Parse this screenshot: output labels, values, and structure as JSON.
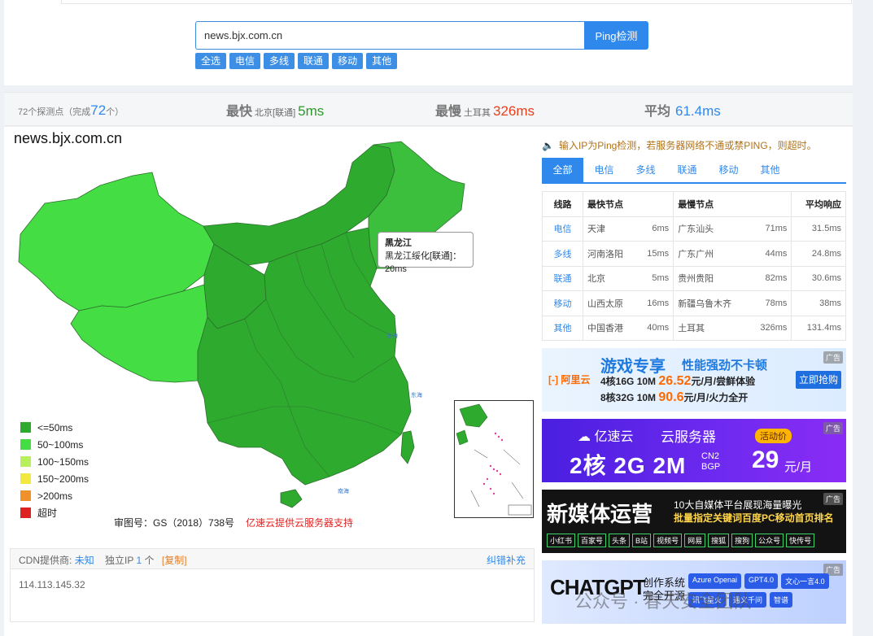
{
  "search": {
    "value": "news.bjx.com.cn",
    "button": "Ping检测"
  },
  "chips": [
    "全选",
    "电信",
    "多线",
    "联通",
    "移动",
    "其他"
  ],
  "stats": {
    "nodes_prefix": "72个探测点（完成",
    "nodes_done": "72",
    "nodes_suffix": "个）",
    "fast_label": "最快",
    "fast_loc": "北京[联通]",
    "fast_val": "5ms",
    "slow_label": "最慢",
    "slow_loc": "土耳其",
    "slow_val": "326ms",
    "avg_label": "平均",
    "avg_val": "61.4ms"
  },
  "map": {
    "title": "news.bjx.com.cn",
    "tooltip": {
      "title": "黑龙江",
      "detail": "黑龙江绥化[联通]：20ms"
    },
    "approval": "审图号：GS（2018）738号",
    "cloud_note": "亿速云提供云服务器支持",
    "legend": [
      {
        "label": "<=50ms",
        "color": "#2eab2e"
      },
      {
        "label": "50~100ms",
        "color": "#44dd44"
      },
      {
        "label": "100~150ms",
        "color": "#b8ef5a"
      },
      {
        "label": "150~200ms",
        "color": "#f2e93e"
      },
      {
        "label": ">200ms",
        "color": "#f0922c"
      },
      {
        "label": "超时",
        "color": "#dd2222"
      }
    ]
  },
  "cdn": {
    "label": "CDN提供商:",
    "provider": "未知",
    "ip_label": "独立IP",
    "ip_count": "1",
    "ip_unit": "个",
    "copy": "[复制]",
    "fix": "纠错补充",
    "ip": "114.113.145.32"
  },
  "notice": "输入IP为Ping检测，若服务器网络不通或禁PING，则超时。",
  "tabs": [
    "全部",
    "电信",
    "多线",
    "联通",
    "移动",
    "其他"
  ],
  "table": {
    "headers": [
      "线路",
      "最快节点",
      "最慢节点",
      "平均响应"
    ],
    "rows": [
      {
        "line": "电信",
        "fast": "天津",
        "fast_ms": "6ms",
        "slow": "广东汕头",
        "slow_ms": "71ms",
        "avg": "31.5ms"
      },
      {
        "line": "多线",
        "fast": "河南洛阳",
        "fast_ms": "15ms",
        "slow": "广东广州",
        "slow_ms": "44ms",
        "avg": "24.8ms"
      },
      {
        "line": "联通",
        "fast": "北京",
        "fast_ms": "5ms",
        "slow": "贵州贵阳",
        "slow_ms": "82ms",
        "avg": "30.6ms"
      },
      {
        "line": "移动",
        "fast": "山西太原",
        "fast_ms": "16ms",
        "slow": "新疆乌鲁木齐",
        "slow_ms": "78ms",
        "avg": "38ms"
      },
      {
        "line": "其他",
        "fast": "中国香港",
        "fast_ms": "40ms",
        "slow": "土耳其",
        "slow_ms": "326ms",
        "avg": "131.4ms"
      }
    ]
  },
  "ads": {
    "tag": "广告",
    "ad1": {
      "title": "游戏专享",
      "slogan": "性能强劲不卡顿",
      "brand": "阿里云",
      "spec1": "4核16G 10M",
      "price1": "26.52",
      "unit1": "元/月/尝鲜体验",
      "spec2": "8核32G 10M",
      "price2": "90.6",
      "unit2": "元/月/火力全开",
      "cta": "立即抢购"
    },
    "ad2": {
      "brand": "亿速云",
      "title": "云服务器",
      "badge": "活动价",
      "spec": "2核 2G 2M",
      "spec_small1": "CN2",
      "spec_small2": "BGP",
      "price": "29",
      "unit": "元/月"
    },
    "ad3": {
      "title": "新媒体运营",
      "line1": "10大自媒体平台展现海量曝光",
      "line2": "批量指定关键词百度PC移动首页排名",
      "platforms": [
        "小红书",
        "百家号",
        "头条",
        "B站",
        "视频号",
        "网易",
        "搜狐",
        "搜狗",
        "公众号",
        "快传号"
      ]
    },
    "ad4": {
      "title": "CHATGPT",
      "sub1": "创作系统",
      "sub2": "完全开源",
      "chips": [
        "Azure Openai",
        "GPT4.0",
        "文心一言4.0",
        "讯飞星火",
        "通义千问",
        "智谱"
      ]
    }
  },
  "watermark": "公众号 · 春天安全团队"
}
